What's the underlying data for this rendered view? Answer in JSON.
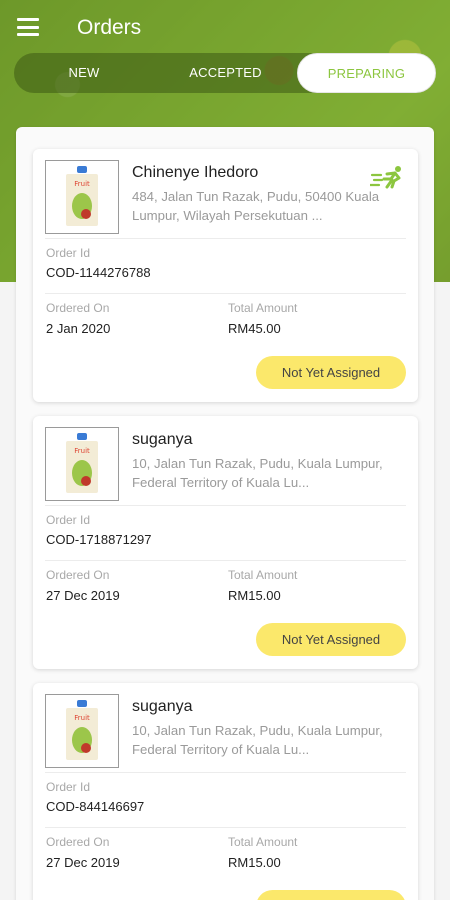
{
  "header": {
    "title": "Orders"
  },
  "tabs": [
    {
      "label": "NEW"
    },
    {
      "label": "ACCEPTED"
    },
    {
      "label": "PREPARING"
    }
  ],
  "active_tab": "PREPARING",
  "labels": {
    "order_id": "Order Id",
    "ordered_on": "Ordered On",
    "total_amount": "Total Amount"
  },
  "orders": [
    {
      "customer": "Chinenye Ihedoro",
      "address": "484, Jalan Tun Razak, Pudu, 50400 Kuala Lumpur, Wilayah Persekutuan ...",
      "order_id": "COD-1144276788",
      "ordered_on": "2 Jan 2020",
      "total": "RM45.00",
      "status": "Not Yet Assigned",
      "has_delivery_icon": true
    },
    {
      "customer": "suganya",
      "address": "10, Jalan Tun Razak, Pudu, Kuala Lumpur, Federal Territory of Kuala Lu...",
      "order_id": "COD-1718871297",
      "ordered_on": "27 Dec 2019",
      "total": "RM15.00",
      "status": "Not Yet Assigned",
      "has_delivery_icon": false
    },
    {
      "customer": "suganya",
      "address": "10, Jalan Tun Razak, Pudu, Kuala Lumpur, Federal Territory of Kuala Lu...",
      "order_id": "COD-844146697",
      "ordered_on": "27 Dec 2019",
      "total": "RM15.00",
      "status": "",
      "has_delivery_icon": false
    }
  ],
  "colors": {
    "accent": "#8cc63f",
    "status_badge": "#fbe86b"
  },
  "icons": [
    "menu-icon",
    "delivery-runner-icon",
    "product-pouch-image"
  ]
}
